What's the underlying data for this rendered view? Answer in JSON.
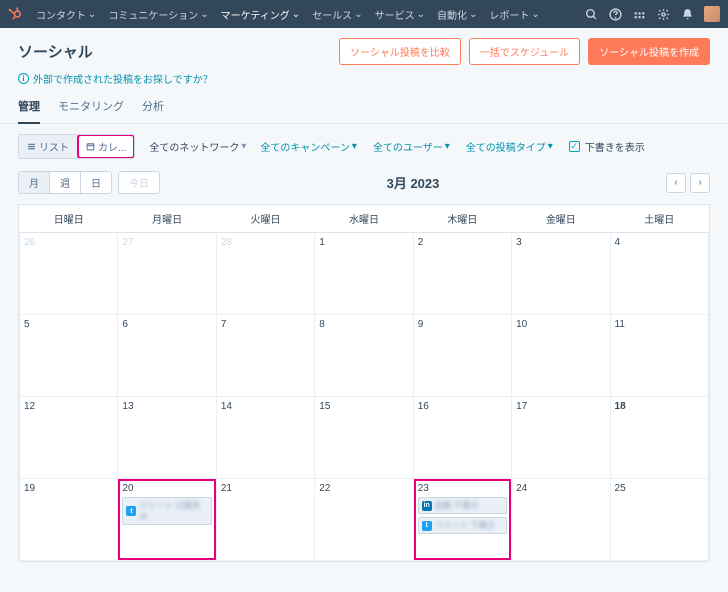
{
  "nav": {
    "items": [
      "コンタクト",
      "コミュニケーション",
      "マーケティング",
      "セールス",
      "サービス",
      "自動化",
      "レポート"
    ],
    "activeIndex": 2
  },
  "page": {
    "title": "ソーシャル",
    "buttons": {
      "compare": "ソーシャル投稿を比較",
      "bulk": "一括でスケジュール",
      "create": "ソーシャル投稿を作成"
    },
    "hint": "外部で作成された投稿をお探しですか？"
  },
  "tabs": {
    "items": [
      "管理",
      "モニタリング",
      "分析"
    ],
    "activeIndex": 0
  },
  "toolbar": {
    "listLabel": "リスト",
    "calendarLabel": "カレ...",
    "networkLabel": "全てのネットワーク",
    "campaignLabel": "全てのキャンペーン",
    "userLabel": "全てのユーザー",
    "postTypeLabel": "全ての投稿タイプ",
    "draftLabel": "下書きを表示"
  },
  "period": {
    "month": "月",
    "week": "週",
    "day": "日",
    "today": "今日",
    "label": "3月 2023"
  },
  "calendar": {
    "dow": [
      "日曜日",
      "月曜日",
      "火曜日",
      "水曜日",
      "木曜日",
      "金曜日",
      "土曜日"
    ],
    "cells": [
      {
        "d": "26",
        "other": true
      },
      {
        "d": "27",
        "other": true
      },
      {
        "d": "28",
        "other": true
      },
      {
        "d": "1"
      },
      {
        "d": "2"
      },
      {
        "d": "3"
      },
      {
        "d": "4"
      },
      {
        "d": "5"
      },
      {
        "d": "6"
      },
      {
        "d": "7"
      },
      {
        "d": "8"
      },
      {
        "d": "9"
      },
      {
        "d": "10"
      },
      {
        "d": "11"
      },
      {
        "d": "12"
      },
      {
        "d": "13"
      },
      {
        "d": "14"
      },
      {
        "d": "15"
      },
      {
        "d": "16"
      },
      {
        "d": "17"
      },
      {
        "d": "18",
        "today": true
      },
      {
        "d": "19"
      },
      {
        "d": "20",
        "hl": true,
        "posts": [
          {
            "net": "tw",
            "text": "ツイート 公開済み"
          }
        ]
      },
      {
        "d": "21"
      },
      {
        "d": "22"
      },
      {
        "d": "23",
        "hl": true,
        "posts": [
          {
            "net": "li",
            "text": "投稿 下書き"
          },
          {
            "net": "tw",
            "text": "ツイート 下書き"
          }
        ]
      },
      {
        "d": "24"
      },
      {
        "d": "25"
      }
    ]
  }
}
